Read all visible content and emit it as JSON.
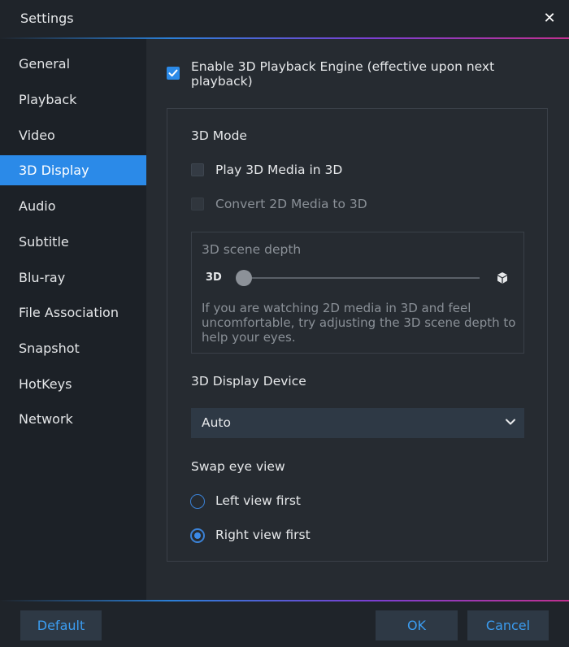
{
  "window": {
    "title": "Settings",
    "close_icon": "close-icon"
  },
  "colors": {
    "accent": "#2b8ae8",
    "sidebar_bg": "#1c2127",
    "content_bg": "#262b31",
    "button_text": "#3b9cf0"
  },
  "sidebar": {
    "items": [
      {
        "label": "General",
        "active": false
      },
      {
        "label": "Playback",
        "active": false
      },
      {
        "label": "Video",
        "active": false
      },
      {
        "label": "3D Display",
        "active": true
      },
      {
        "label": "Audio",
        "active": false
      },
      {
        "label": "Subtitle",
        "active": false
      },
      {
        "label": "Blu-ray",
        "active": false
      },
      {
        "label": "File Association",
        "active": false
      },
      {
        "label": "Snapshot",
        "active": false
      },
      {
        "label": "HotKeys",
        "active": false
      },
      {
        "label": "Network",
        "active": false
      }
    ]
  },
  "main": {
    "enable_engine": {
      "line1": "Enable 3D Playback Engine (effective upon next",
      "line2": "playback)",
      "checked": true
    },
    "mode": {
      "heading": "3D Mode",
      "play_3d": {
        "label": "Play 3D Media in 3D",
        "checked": false
      },
      "convert_2d": {
        "label": "Convert 2D Media to 3D",
        "checked": false,
        "disabled": true
      }
    },
    "depth": {
      "heading": "3D scene depth",
      "slider_left_label": "3D",
      "slider_right_icon": "cube-icon",
      "slider_value": 0,
      "hint": "If you are watching 2D media in 3D and feel uncomfortable, try adjusting the 3D scene depth to help your eyes."
    },
    "device": {
      "heading": "3D Display Device",
      "selected": "Auto",
      "icon": "chevron-down-icon"
    },
    "swap": {
      "heading": "Swap eye view",
      "options": [
        {
          "label": "Left view first",
          "selected": false
        },
        {
          "label": "Right view first",
          "selected": true
        }
      ]
    }
  },
  "footer": {
    "default_label": "Default",
    "ok_label": "OK",
    "cancel_label": "Cancel"
  }
}
